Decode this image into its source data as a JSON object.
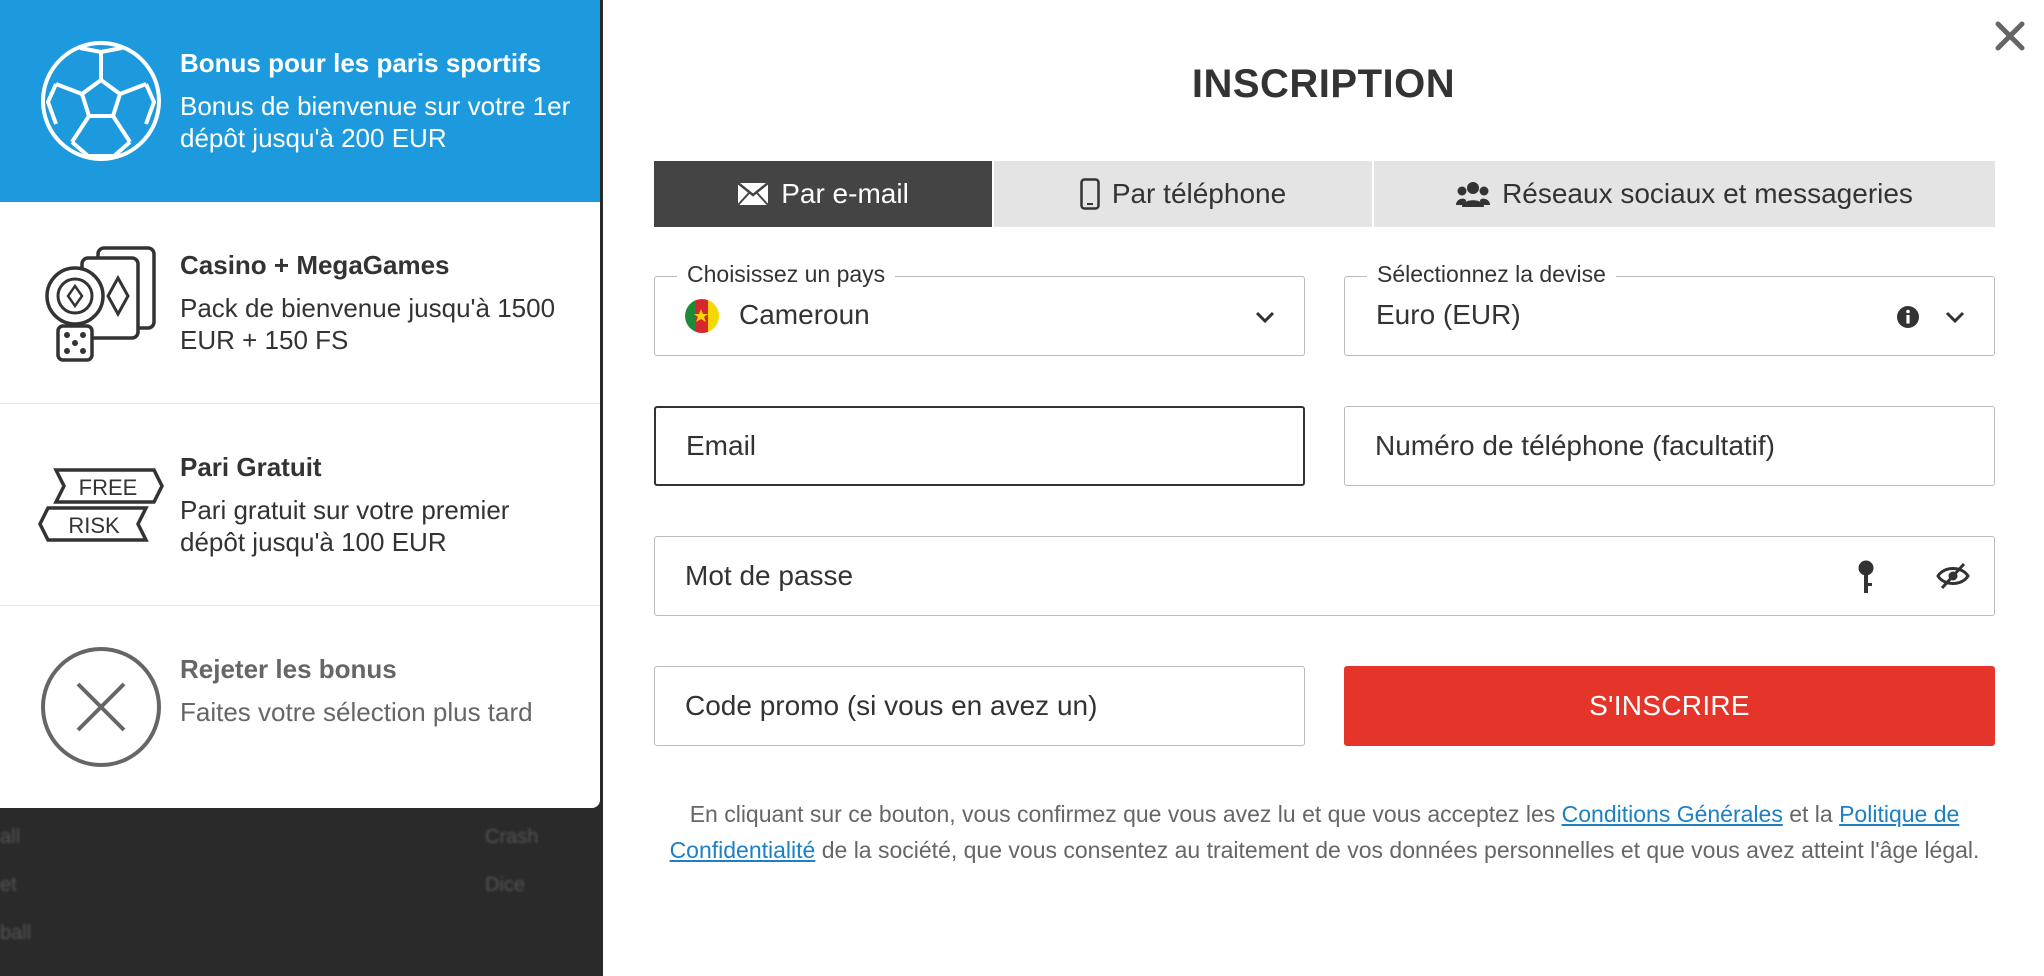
{
  "background": {
    "hints": [
      "all",
      "Crash",
      "et",
      "Dice",
      "ball"
    ]
  },
  "bonuses": [
    {
      "title": "Bonus pour les paris sportifs",
      "description": "Bonus de bienvenue sur votre 1er dépôt jusqu'à 200 EUR",
      "icon": "soccer-ball-icon",
      "selected": true
    },
    {
      "title": "Casino + MegaGames",
      "description": "Pack de bienvenue jusqu'à 1500 EUR + 150 FS",
      "icon": "casino-cards-icon",
      "selected": false
    },
    {
      "title": "Pari Gratuit",
      "description": "Pari gratuit sur votre premier dépôt jusqu'à 100 EUR",
      "icon": "free-risk-icon",
      "icon_text": [
        "FREE",
        "RISK"
      ],
      "selected": false
    },
    {
      "title": "Rejeter les bonus",
      "description": "Faites votre sélection plus tard",
      "icon": "reject-x-icon",
      "selected": false
    }
  ],
  "modal": {
    "title": "INSCRIPTION",
    "tabs": [
      {
        "label": "Par e-mail",
        "icon": "envelope-icon",
        "active": true
      },
      {
        "label": "Par téléphone",
        "icon": "phone-icon",
        "active": false
      },
      {
        "label": "Réseaux sociaux et messageries",
        "icon": "users-icon",
        "active": false
      }
    ],
    "country": {
      "label": "Choisissez un pays",
      "value": "Cameroun"
    },
    "currency": {
      "label": "Sélectionnez la devise",
      "value": "Euro (EUR)"
    },
    "email": {
      "placeholder": "Email"
    },
    "phone": {
      "placeholder": "Numéro de téléphone (facultatif)"
    },
    "password": {
      "placeholder": "Mot de passe"
    },
    "promo": {
      "placeholder": "Code promo (si vous en avez un)"
    },
    "submit_label": "S'INSCRIRE",
    "terms": {
      "before": "En cliquant sur ce bouton, vous confirmez que vous avez lu et que vous acceptez les ",
      "link1": "Conditions Générales",
      "middle": " et la ",
      "link2": "Politique de Confidentialité",
      "after": " de la société, que vous consentez au traitement de vos données personnelles et que vous avez atteint l'âge légal."
    }
  },
  "colors": {
    "accent_blue": "#1d9ade",
    "submit_red": "#e5352b",
    "tab_active": "#444444",
    "link": "#1d7fc4"
  }
}
